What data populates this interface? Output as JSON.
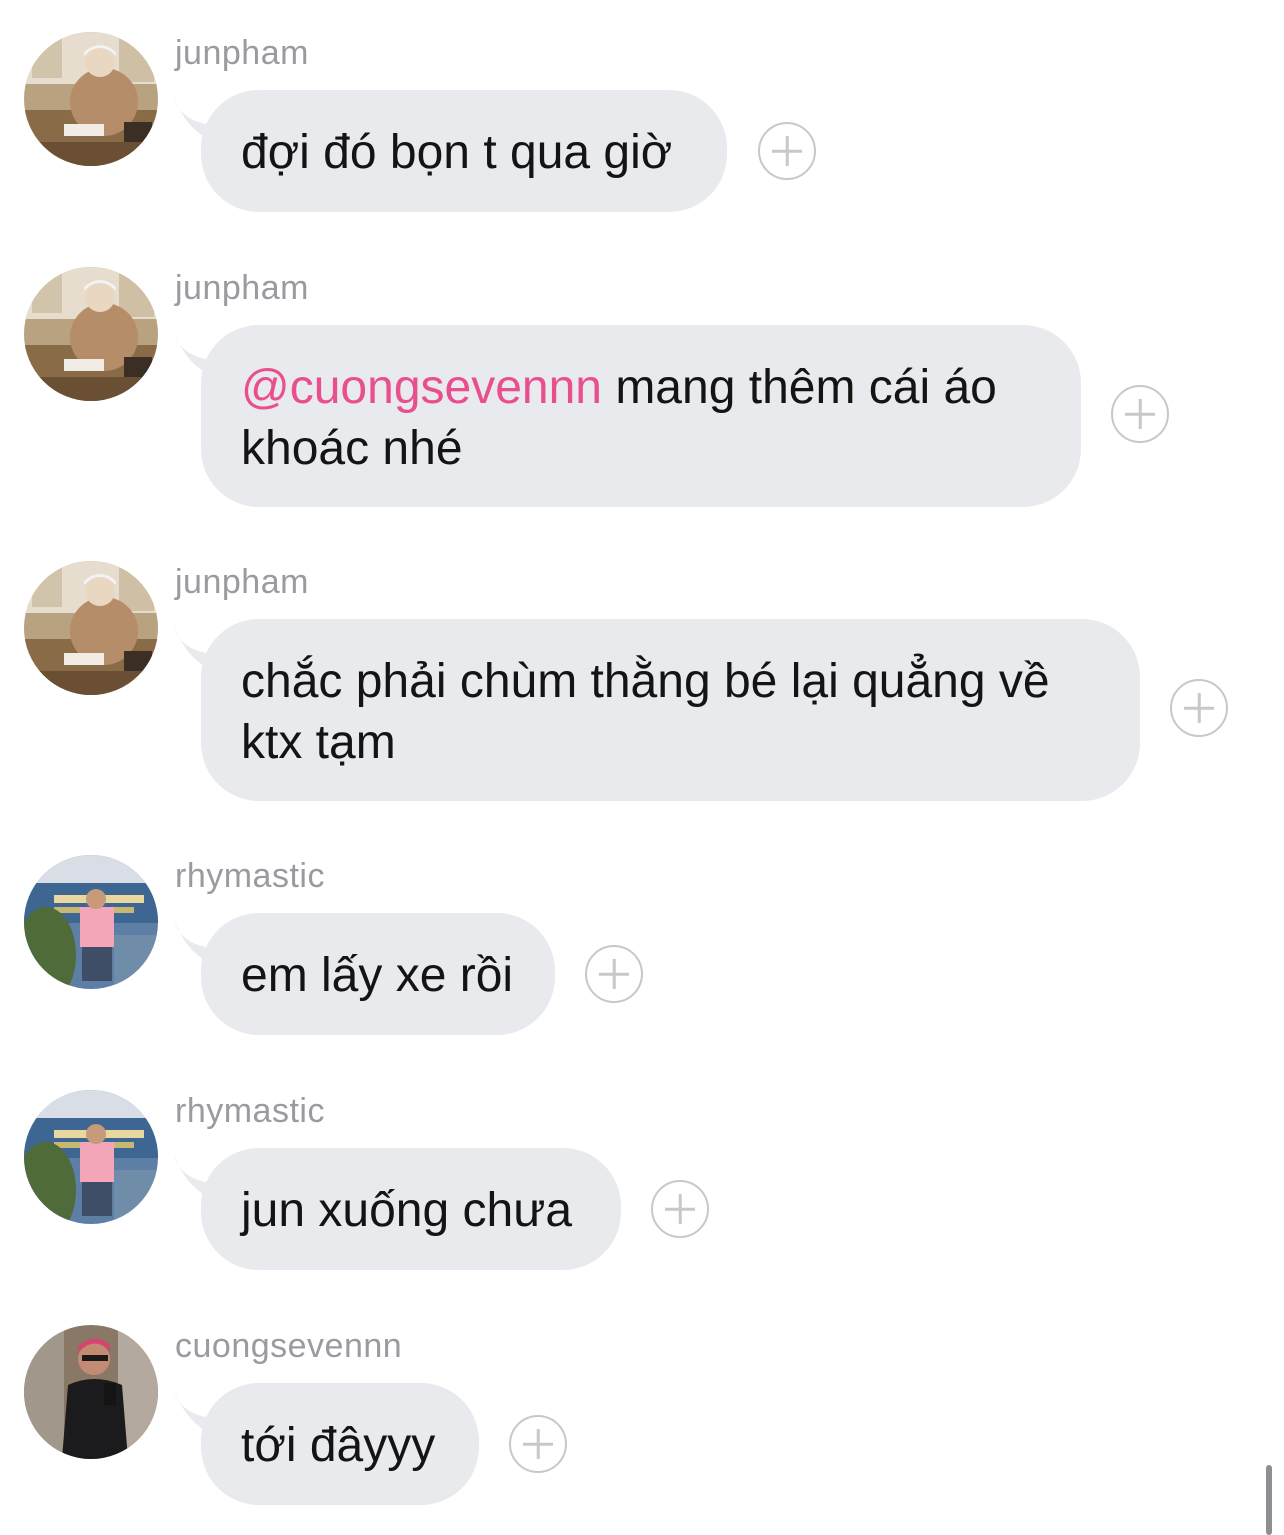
{
  "messages": [
    {
      "sender": "junpham",
      "text": "đợi đó bọn t qua giờ",
      "avatar": "junpham-avatar"
    },
    {
      "sender": "junpham",
      "mention": "@cuongsevennn",
      "text_line1": " mang thêm cái áo",
      "text_line2": "khoác nhé",
      "avatar": "junpham-avatar"
    },
    {
      "sender": "junpham",
      "text_line1": "chắc phải chùm thằng bé lại quẳng về",
      "text_line2": "ktx tạm",
      "avatar": "junpham-avatar"
    },
    {
      "sender": "rhymastic",
      "text": "em lấy xe rồi",
      "avatar": "rhymastic-avatar"
    },
    {
      "sender": "rhymastic",
      "text": "jun xuống chưa",
      "avatar": "rhymastic-avatar"
    },
    {
      "sender": "cuongsevennn",
      "text": "tới đâyyy",
      "avatar": "cuongsevennn-avatar"
    }
  ],
  "colors": {
    "bubble": "#e8eaed",
    "mention": "#e94e8e",
    "sender": "#9a9ba0",
    "add_icon": "#c7c7cc"
  },
  "icons": {
    "reaction": "add-reaction-icon"
  }
}
